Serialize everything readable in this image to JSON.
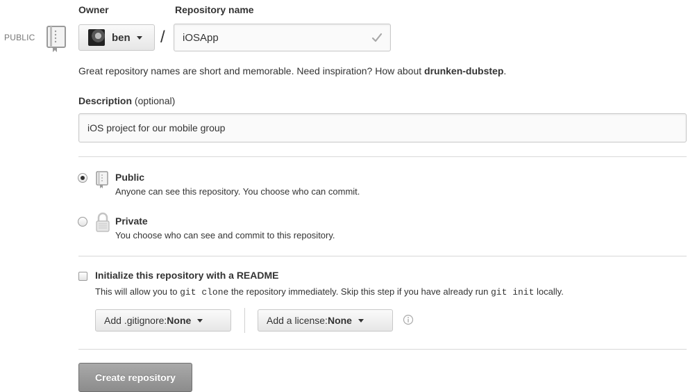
{
  "owner": {
    "label": "Owner",
    "selected": "ben"
  },
  "repo": {
    "label": "Repository name",
    "value": "iOSApp",
    "separator": "/"
  },
  "visibility_badge": "PUBLIC",
  "hint": {
    "text": "Great repository names are short and memorable. Need inspiration? How about ",
    "suggestion": "drunken-dubstep",
    "end": "."
  },
  "description": {
    "label": "Description",
    "optional": " (optional)",
    "value": "iOS project for our mobile group"
  },
  "visibility": {
    "selected": "public",
    "public": {
      "title": "Public",
      "desc": "Anyone can see this repository. You choose who can commit."
    },
    "private": {
      "title": "Private",
      "desc": "You choose who can see and commit to this repository."
    }
  },
  "init": {
    "checked": false,
    "title": "Initialize this repository with a README",
    "desc_1": "This will allow you to ",
    "cmd_1": "git clone",
    "desc_2": " the repository immediately. Skip this step if you have already run ",
    "cmd_2": "git init",
    "desc_3": " locally."
  },
  "gitignore": {
    "label": "Add .gitignore: ",
    "value": "None"
  },
  "license": {
    "label": "Add a license: ",
    "value": "None"
  },
  "create_button": "Create repository",
  "icons": {
    "visibility_badge": "repo-book-icon",
    "owner_avatar": "avatar",
    "repo_valid": "checkmark-icon",
    "public": "repo-book-icon",
    "private": "lock-icon",
    "license_info": "info-icon"
  }
}
